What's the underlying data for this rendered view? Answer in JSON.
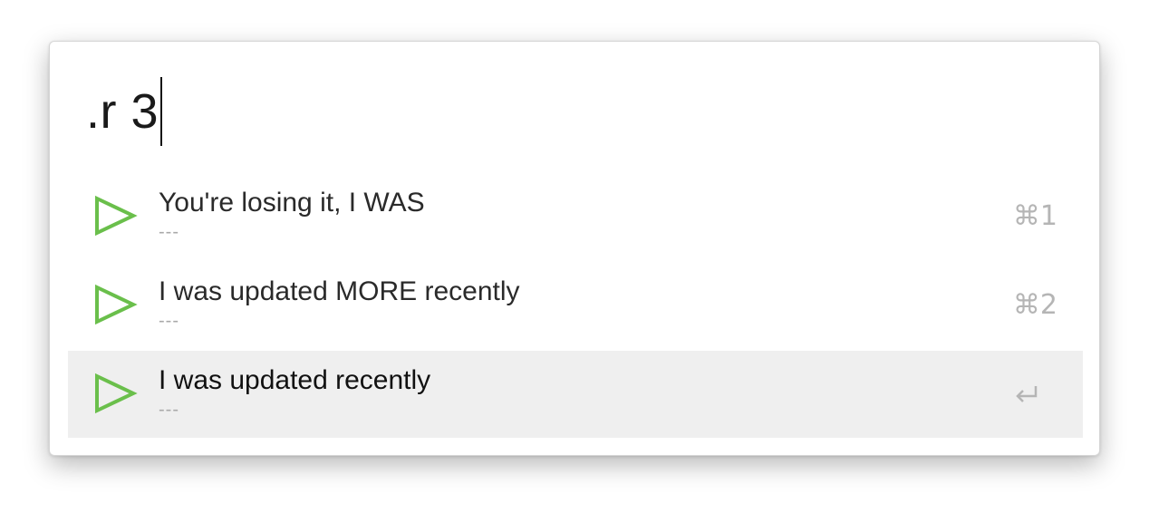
{
  "query": {
    "text": ".r 3"
  },
  "results": [
    {
      "title": "You're losing it, I WAS",
      "subtitle": "---",
      "shortcut": "⌘1",
      "icon": "play-triangle-icon",
      "selected": false
    },
    {
      "title": "I was updated MORE recently",
      "subtitle": "---",
      "shortcut": "⌘2",
      "icon": "play-triangle-icon",
      "selected": false
    },
    {
      "title": "I was updated recently",
      "subtitle": "---",
      "shortcut": "",
      "icon": "play-triangle-icon",
      "action_icon": "return-key-icon",
      "selected": true
    }
  ],
  "colors": {
    "icon_green": "#6abf4b",
    "selected_bg": "#efefef",
    "shortcut_gray": "#b5b5b5"
  }
}
